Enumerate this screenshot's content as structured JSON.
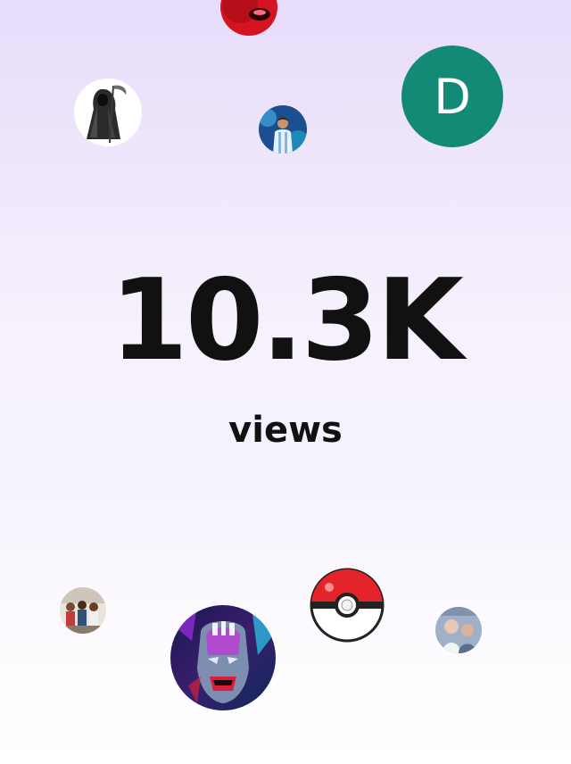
{
  "stats": {
    "value": "10.3K",
    "label": "views"
  },
  "avatars": {
    "letter": "D"
  },
  "colors": {
    "letter_avatar_bg": "#128a75",
    "text": "#111111",
    "background_top": "#e7dcfb",
    "background_bottom": "#ffffff"
  }
}
